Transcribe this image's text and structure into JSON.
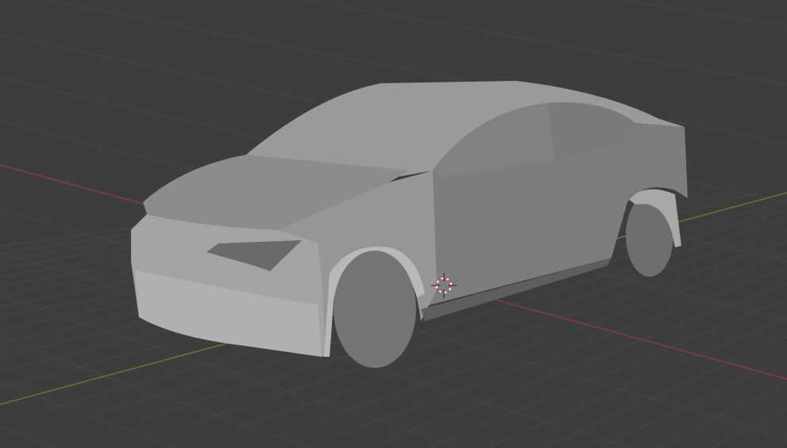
{
  "viewport": {
    "background_color": "#3d3d3d",
    "grid_color": "#474747",
    "x_axis_color": "#8a3a40",
    "y_axis_color": "#5e7d2c",
    "model_base_color": "#8e8e8e"
  },
  "scene": {
    "object": "car-model",
    "cursor_icon": "3d-cursor-icon"
  }
}
